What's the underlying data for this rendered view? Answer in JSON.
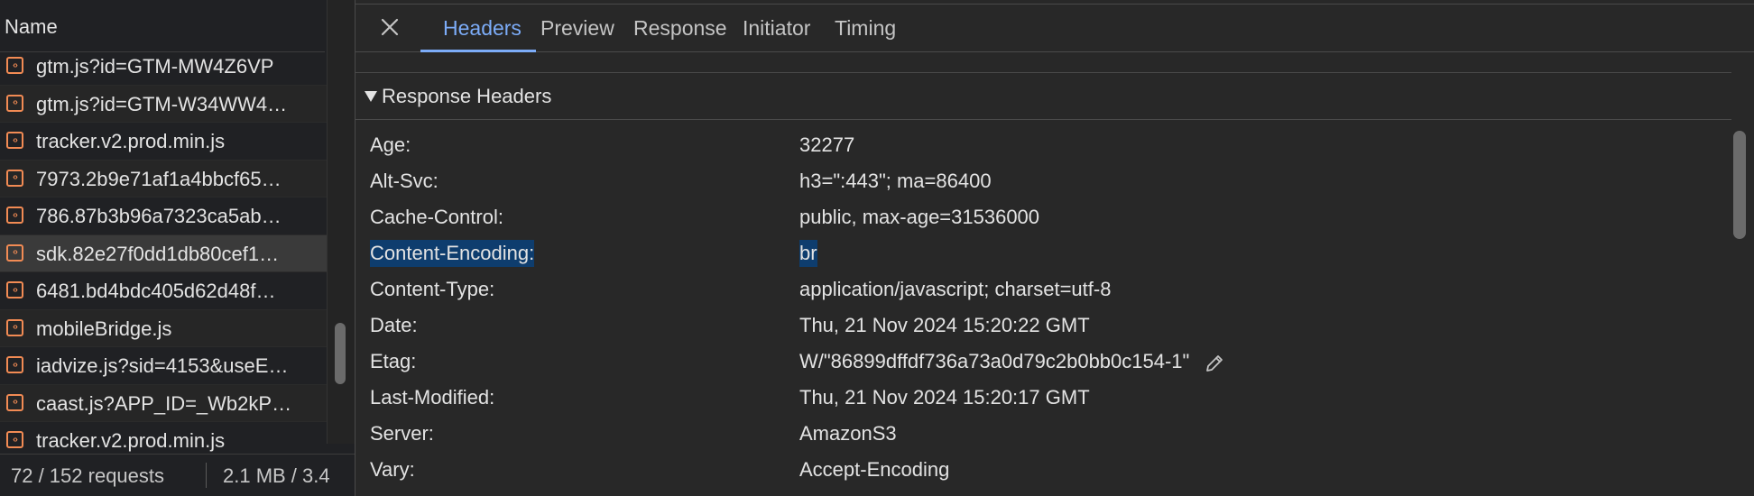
{
  "request_list": {
    "header": "Name",
    "items": [
      {
        "name": "gtm.js?id=GTM-MW4Z6VP"
      },
      {
        "name": "gtm.js?id=GTM-W34WW4…"
      },
      {
        "name": "tracker.v2.prod.min.js"
      },
      {
        "name": "7973.2b9e71af1a4bbcf65…"
      },
      {
        "name": "786.87b3b96a7323ca5ab…"
      },
      {
        "name": "sdk.82e27f0dd1db80cef1…",
        "selected": true
      },
      {
        "name": "6481.bd4bdc405d62d48f…"
      },
      {
        "name": "mobileBridge.js"
      },
      {
        "name": "iadvize.js?sid=4153&useE…"
      },
      {
        "name": "caast.js?APP_ID=_Wb2kP…"
      },
      {
        "name": "tracker.v2.prod.min.js"
      }
    ],
    "file_icon": "script-file-icon"
  },
  "status_bar": {
    "requests": "72 / 152 requests",
    "transferred": "2.1 MB / 3.4"
  },
  "tabs": [
    {
      "label": "Headers",
      "active": true
    },
    {
      "label": "Preview"
    },
    {
      "label": "Response"
    },
    {
      "label": "Initiator"
    },
    {
      "label": "Timing"
    }
  ],
  "response_headers": {
    "title": "Response Headers",
    "rows": [
      {
        "key": "Age:",
        "value": "32277"
      },
      {
        "key": "Alt-Svc:",
        "value": "h3=\":443\"; ma=86400"
      },
      {
        "key": "Cache-Control:",
        "value": "public, max-age=31536000"
      },
      {
        "key": "Content-Encoding:",
        "value": "br",
        "highlighted": true
      },
      {
        "key": "Content-Type:",
        "value": "application/javascript; charset=utf-8"
      },
      {
        "key": "Date:",
        "value": "Thu, 21 Nov 2024 15:20:22 GMT"
      },
      {
        "key": "Etag:",
        "value": "W/\"86899dffdf736a73a0d79c2b0bb0c154-1\"",
        "editable": true
      },
      {
        "key": "Last-Modified:",
        "value": "Thu, 21 Nov 2024 15:20:17 GMT"
      },
      {
        "key": "Server:",
        "value": "AmazonS3"
      },
      {
        "key": "Vary:",
        "value": "Accept-Encoding"
      }
    ]
  },
  "colors": {
    "accent": "#7cacf8",
    "selection_highlight": "#0e3d6e",
    "script_icon": "#f28b54"
  }
}
